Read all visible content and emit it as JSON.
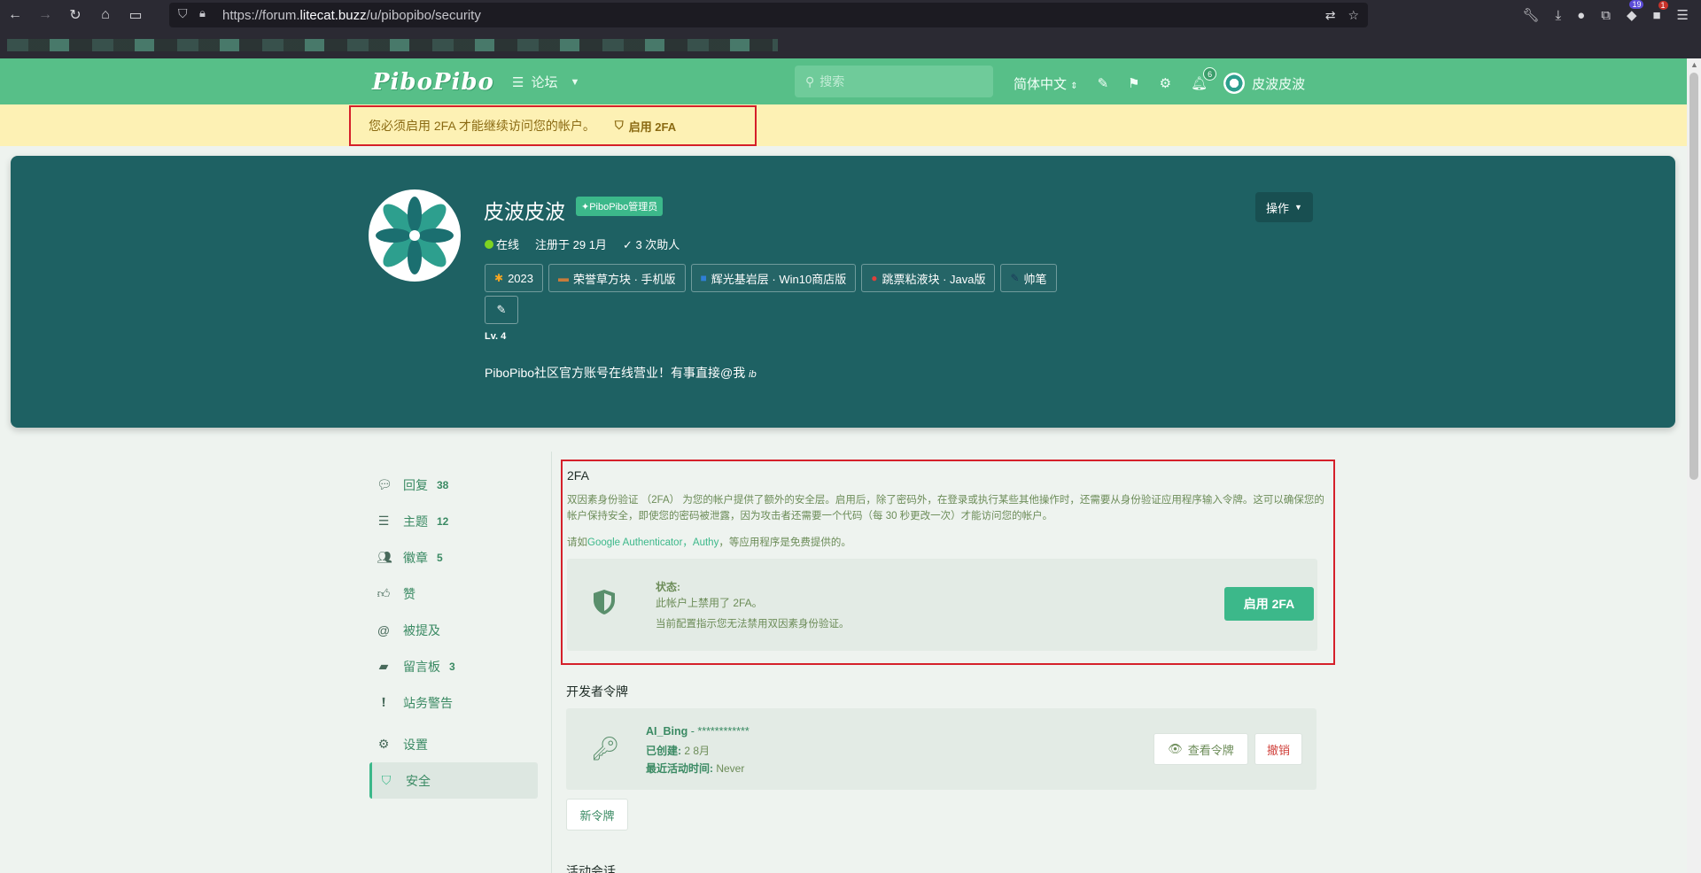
{
  "browser": {
    "url_prefix": "https://forum.",
    "url_host": "litecat.buzz",
    "url_path": "/u/pibopibo/security",
    "ext_badge_1": "19",
    "ext_badge_2": "1"
  },
  "header": {
    "logo": "PiboPibo",
    "forum_label": "论坛",
    "search_placeholder": "搜索",
    "language": "简体中文",
    "notification_count": "6",
    "username": "皮波皮波"
  },
  "alert": {
    "message": "您必须启用 2FA 才能继续访问您的帐户。",
    "link": "启用 2FA"
  },
  "profile": {
    "name": "皮波皮波",
    "badge": "PiboPibo管理员",
    "status": "在线",
    "registered": "注册于 29 1月",
    "helped": "3 次助人",
    "tags": [
      {
        "icon": "✱",
        "color": "#f5a623",
        "label": "2023"
      },
      {
        "icon": "▬",
        "color": "#c97c3a",
        "label": "荣誉草方块 · 手机版"
      },
      {
        "icon": "■",
        "color": "#2f7fd6",
        "label": "辉光基岩层 · Win10商店版"
      },
      {
        "icon": "●",
        "color": "#e0413b",
        "label": "跳票粘液块 · Java版"
      },
      {
        "icon": "✎",
        "color": "#1b3a5a",
        "label": "帅笔"
      }
    ],
    "level": "Lv. 4",
    "bio": "PiboPibo社区官方账号在线营业！有事直接@我",
    "bio_suffix": "ib",
    "actions_button": "操作"
  },
  "sidebar": {
    "items": [
      {
        "icon": "comment",
        "label": "回复",
        "count": "38"
      },
      {
        "icon": "list",
        "label": "主题",
        "count": "12"
      },
      {
        "icon": "users",
        "label": "徽章",
        "count": "5"
      },
      {
        "icon": "thumbs-up",
        "label": "赞",
        "count": ""
      },
      {
        "icon": "at",
        "label": "被提及",
        "count": ""
      },
      {
        "icon": "note",
        "label": "留言板",
        "count": "3"
      },
      {
        "icon": "warning",
        "label": "站务警告",
        "count": ""
      },
      {
        "icon": "gear",
        "label": "设置",
        "count": ""
      },
      {
        "icon": "shield",
        "label": "安全",
        "count": ""
      }
    ]
  },
  "twofa": {
    "title": "2FA",
    "description": "双因素身份验证 （2FA） 为您的帐户提供了额外的安全层。启用后，除了密码外，在登录或执行某些其他操作时，还需要从身份验证应用程序输入令牌。这可以确保您的帐户保持安全，即使您的密码被泄露，因为攻击者还需要一个代码（每 30 秒更改一次）才能访问您的帐户。",
    "apps_prefix": "请如",
    "apps_link": "Google Authenticator，Authy",
    "apps_suffix": "，等应用程序是免费提供的。",
    "status_label": "状态:",
    "status_value": "此帐户上禁用了 2FA。",
    "status_note": "当前配置指示您无法禁用双因素身份验证。",
    "enable_button": "启用 2FA"
  },
  "developer": {
    "title": "开发者令牌",
    "token_name": "AI_Bing",
    "token_mask": " - ************",
    "created_label": "已创建:",
    "created_value": " 2 8月",
    "last_active_label": "最近活动时间:",
    "last_active_value": " Never",
    "view_button": "查看令牌",
    "revoke_button": "撤销",
    "new_button": "新令牌"
  },
  "sessions": {
    "title": "活动会话"
  }
}
